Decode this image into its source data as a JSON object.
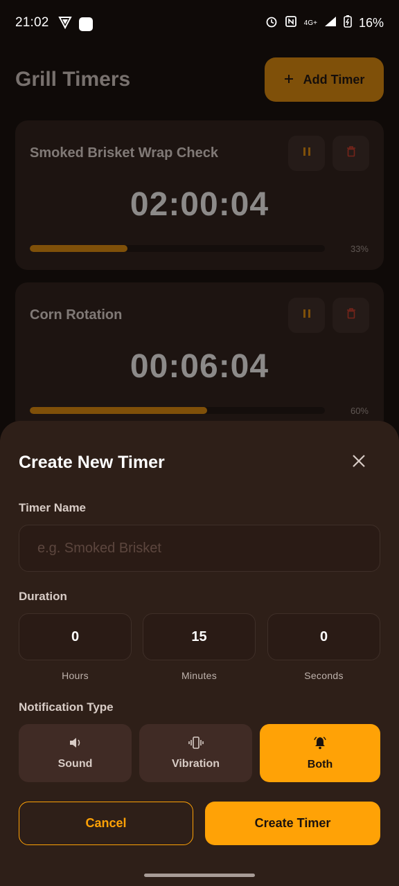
{
  "status_bar": {
    "time": "21:02",
    "network": "4G+",
    "battery": "16%"
  },
  "app": {
    "title": "Grill Timers",
    "add_timer_label": "Add Timer",
    "timers": [
      {
        "name": "Smoked Brisket Wrap Check",
        "time": "02:00:04",
        "progress_label": "33%",
        "progress": 0.33
      },
      {
        "name": "Corn Rotation",
        "time": "00:06:04",
        "progress_label": "60%",
        "progress": 0.6
      }
    ]
  },
  "sheet": {
    "title": "Create New Timer",
    "timer_name_label": "Timer Name",
    "timer_name_placeholder": "e.g. Smoked Brisket",
    "timer_name_value": "",
    "duration_label": "Duration",
    "duration": {
      "hours": "0",
      "hours_label": "Hours",
      "minutes": "15",
      "minutes_label": "Minutes",
      "seconds": "0",
      "seconds_label": "Seconds"
    },
    "notification_label": "Notification Type",
    "notification_options": [
      {
        "label": "Sound",
        "icon": "speaker-icon",
        "selected": false
      },
      {
        "label": "Vibration",
        "icon": "vibration-icon",
        "selected": false
      },
      {
        "label": "Both",
        "icon": "bell-icon",
        "selected": true
      }
    ],
    "cancel_label": "Cancel",
    "create_label": "Create Timer"
  },
  "colors": {
    "accent": "#ffa206",
    "sheet_bg": "#2e1f18",
    "delete_red": "#d23c2c"
  }
}
